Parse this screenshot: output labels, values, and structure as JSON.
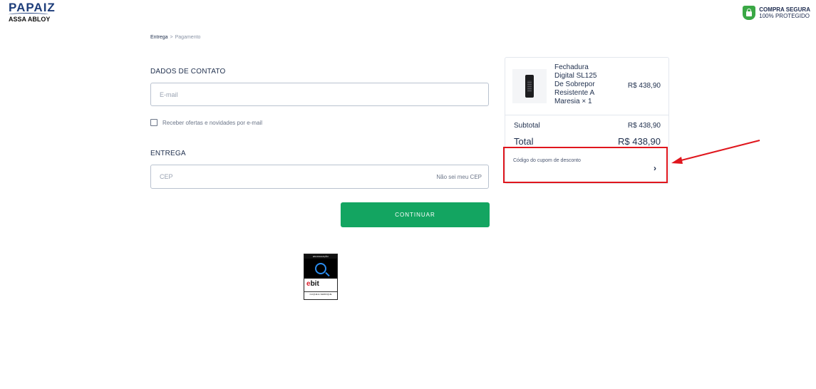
{
  "header": {
    "brand": "PAPAIZ",
    "brand_sub": "ASSA ABLOY",
    "secure_title": "COMPRA SEGURA",
    "secure_sub": "100% PROTEGIDO"
  },
  "breadcrumb": {
    "step1": "Entrega",
    "separator": ">",
    "step2": "Pagamento"
  },
  "contact": {
    "title": "DADOS DE CONTATO",
    "email_placeholder": "E-mail",
    "offers_label": "Receber ofertas e novidades por e-mail"
  },
  "delivery": {
    "title": "ENTREGA",
    "cep_placeholder": "CEP",
    "cep_link": "Não sei meu CEP"
  },
  "continue_label": "CONTINUAR",
  "badge": {
    "top": "EM AVALIAÇÃO",
    "word_e": "e",
    "word_rest": "bit",
    "cta": "CLIQUE E VERIFIQUE"
  },
  "summary": {
    "product_name": "Fechadura Digital SL125 De Sobrepor Resistente A Maresia × 1",
    "product_price": "R$ 438,90",
    "subtotal_label": "Subtotal",
    "subtotal_value": "R$ 438,90",
    "total_label": "Total",
    "total_value": "R$ 438,90",
    "coupon_label": "Código do cupom de desconto"
  },
  "colors": {
    "primary_button": "#13a561",
    "highlight": "#e0161d",
    "secure_green": "#3aa845"
  }
}
